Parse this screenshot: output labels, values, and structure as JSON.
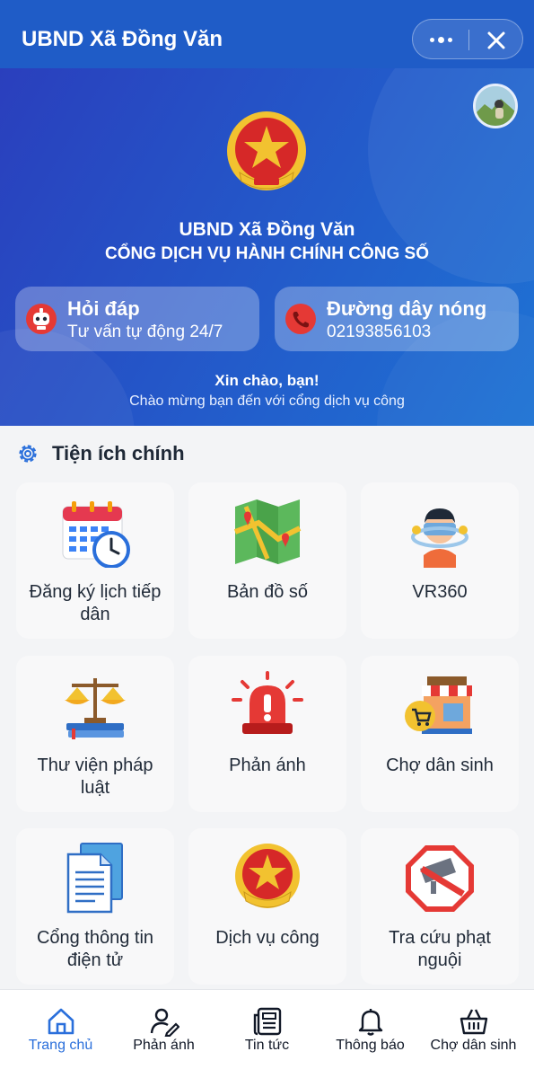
{
  "header": {
    "title": "UBND Xã Đồng Văn",
    "more_icon": "more-dots-icon",
    "close_icon": "close-icon"
  },
  "hero": {
    "title": "UBND Xã Đồng Văn",
    "subtitle": "CỔNG DỊCH VỤ HÀNH CHÍNH CÔNG SỐ",
    "cards": [
      {
        "title": "Hỏi đáp",
        "subtitle": "Tư vấn tự động 24/7",
        "icon": "robot-icon"
      },
      {
        "title": "Đường dây nóng",
        "subtitle": "02193856103",
        "icon": "phone-icon"
      }
    ],
    "greeting": "Xin chào, bạn!",
    "greeting_sub": "Chào mừng bạn đến với cổng dịch vụ công"
  },
  "section": {
    "title": "Tiện ích chính",
    "icon": "gear-icon",
    "tiles": [
      {
        "label": "Đăng ký lịch tiếp dân",
        "icon": "calendar-clock-icon"
      },
      {
        "label": "Bản đồ số",
        "icon": "map-icon"
      },
      {
        "label": "VR360",
        "icon": "vr-headset-icon"
      },
      {
        "label": "Thư viện pháp luật",
        "icon": "law-scale-icon"
      },
      {
        "label": "Phản ánh",
        "icon": "alarm-siren-icon"
      },
      {
        "label": "Chợ dân sinh",
        "icon": "market-shop-icon"
      },
      {
        "label": "Cổng thông tin điện tử",
        "icon": "document-icon"
      },
      {
        "label": "Dịch vụ công",
        "icon": "national-emblem-icon"
      },
      {
        "label": "Tra cứu phạt nguội",
        "icon": "traffic-camera-icon"
      }
    ]
  },
  "nav": {
    "items": [
      {
        "label": "Trang chủ",
        "icon": "home-icon",
        "active": true
      },
      {
        "label": "Phản ánh",
        "icon": "user-edit-icon",
        "active": false
      },
      {
        "label": "Tin tức",
        "icon": "newspaper-icon",
        "active": false
      },
      {
        "label": "Thông báo",
        "icon": "bell-icon",
        "active": false
      },
      {
        "label": "Chợ dân sinh",
        "icon": "basket-icon",
        "active": false
      }
    ]
  },
  "colors": {
    "header_bg": "#1f5cc7",
    "active_nav": "#2a6fdb",
    "emblem_red": "#d62828",
    "emblem_gold": "#f2c230"
  }
}
